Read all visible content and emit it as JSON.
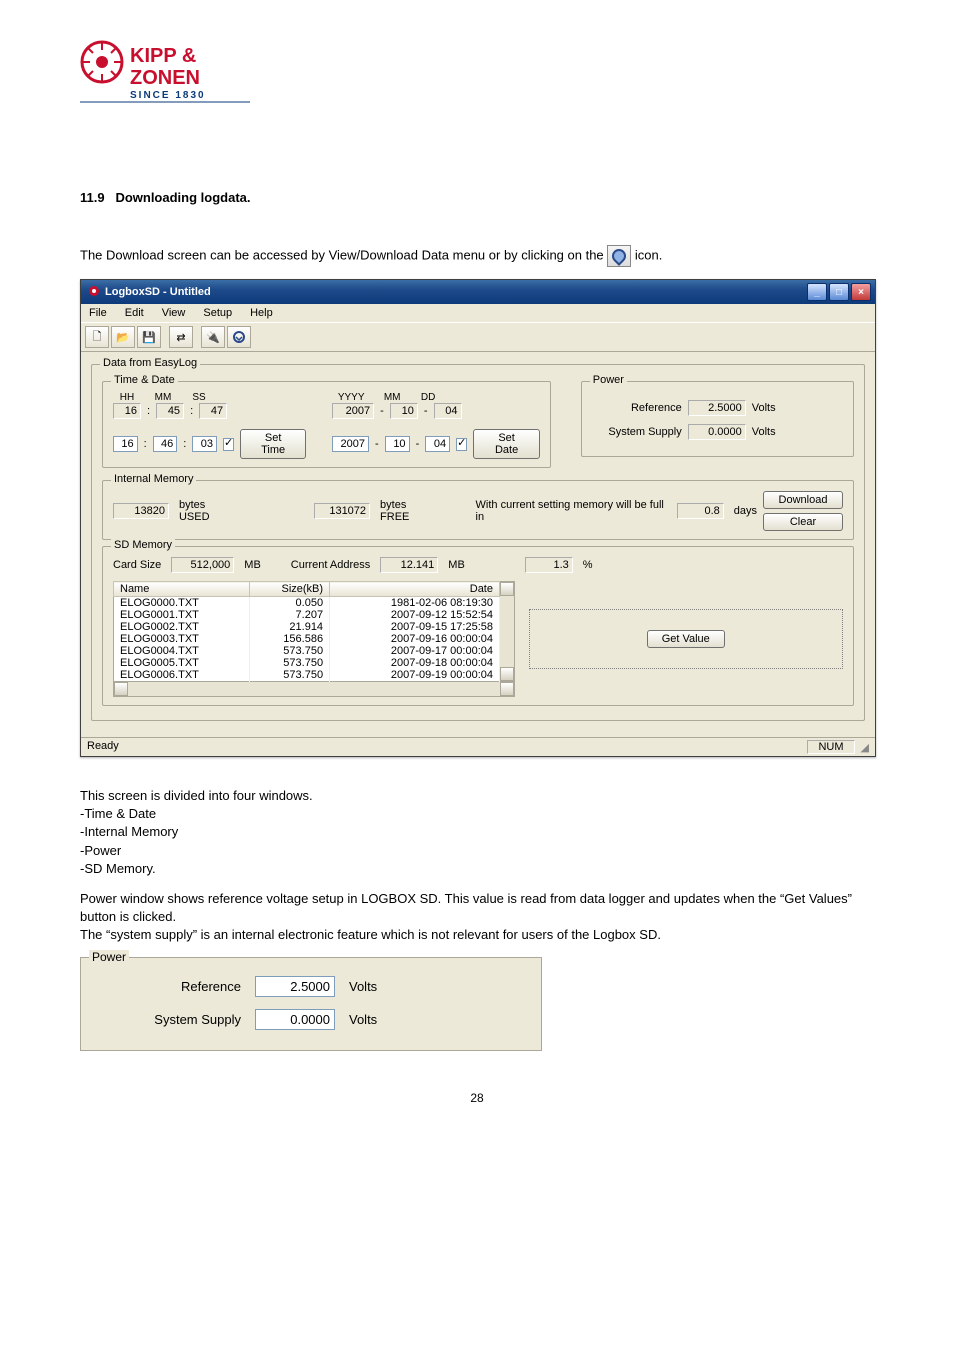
{
  "section_number": "11.9",
  "section_title": "Downloading logdata.",
  "intro_text": "The Download screen can be accessed by View/Download Data menu or by clicking on the ",
  "intro_text_suffix": " icon.",
  "app": {
    "title": "LogboxSD - Untitled",
    "menus": [
      "File",
      "Edit",
      "View",
      "Setup",
      "Help"
    ],
    "status_left": "Ready",
    "status_right": "NUM"
  },
  "groups": {
    "data_from_easylog": "Data from EasyLog",
    "time_date": "Time & Date",
    "power": "Power",
    "internal_memory": "Internal Memory",
    "sd_memory": "SD Memory"
  },
  "time_date": {
    "labels": {
      "HH": "HH",
      "MM": "MM",
      "SS": "SS",
      "YYYY": "YYYY",
      "MM2": "MM",
      "DD": "DD"
    },
    "row1": {
      "hh": "16",
      "mm": "45",
      "ss": "47",
      "yyyy": "2007",
      "mon": "10",
      "dd": "04"
    },
    "row2": {
      "hh": "16",
      "mm": "46",
      "ss": "03",
      "yyyy": "2007",
      "mon": "10",
      "dd": "04"
    },
    "set_time": "Set Time",
    "set_date": "Set Date"
  },
  "power": {
    "ref_label": "Reference",
    "ref_value": "2.5000",
    "volts": "Volts",
    "sys_label": "System Supply",
    "sys_value": "0.0000"
  },
  "internal_memory": {
    "used_value": "13820",
    "used_label": "bytes USED",
    "free_value": "131072",
    "free_label": "bytes FREE",
    "full_label": "With current setting memory will be full in",
    "days_value": "0.8",
    "days_label": "days",
    "download": "Download",
    "clear": "Clear"
  },
  "sd_memory": {
    "card_size_label": "Card Size",
    "card_size": "512,000",
    "mb": "MB",
    "cur_addr_label": "Current Address",
    "cur_addr": "12.141",
    "pct_value": "1.3",
    "pct": "%",
    "cols": {
      "name": "Name",
      "size": "Size(kB)",
      "date": "Date"
    },
    "rows": [
      {
        "name": "ELOG0000.TXT",
        "size": "0.050",
        "date": "1981-02-06 08:19:30"
      },
      {
        "name": "ELOG0001.TXT",
        "size": "7.207",
        "date": "2007-09-12 15:52:54"
      },
      {
        "name": "ELOG0002.TXT",
        "size": "21.914",
        "date": "2007-09-15 17:25:58"
      },
      {
        "name": "ELOG0003.TXT",
        "size": "156.586",
        "date": "2007-09-16 00:00:04"
      },
      {
        "name": "ELOG0004.TXT",
        "size": "573.750",
        "date": "2007-09-17 00:00:04"
      },
      {
        "name": "ELOG0005.TXT",
        "size": "573.750",
        "date": "2007-09-18 00:00:04"
      },
      {
        "name": "ELOG0006.TXT",
        "size": "573.750",
        "date": "2007-09-19 00:00:04"
      }
    ],
    "get_value": "Get Value"
  },
  "narrative": {
    "line1": "This screen is divided into four windows.",
    "b1": "-Time & Date",
    "b2": "-Internal Memory",
    "b3": "-Power",
    "b4": "-SD Memory.",
    "p2a": "Power window shows reference voltage setup in LOGBOX SD. This value is read from data logger and updates when the “Get Values” button is clicked.",
    "p2b": "The “system supply” is an internal electronic feature which is not relevant for users of the Logbox SD."
  },
  "page_number": "28"
}
